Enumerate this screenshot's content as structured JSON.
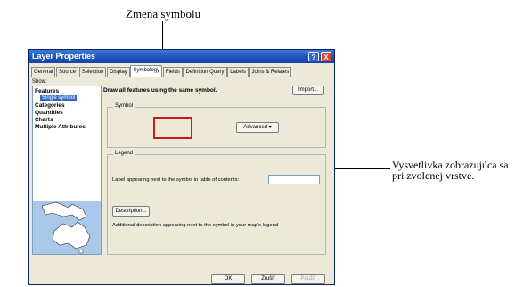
{
  "annotations": {
    "top": "Zmena symbolu",
    "right_line1": "Vysvetlivka zobrazujúca sa",
    "right_line2": "pri zvolenej vrstve."
  },
  "window": {
    "title": "Layer Properties",
    "help": "?",
    "close": "X"
  },
  "tabs": [
    "General",
    "Source",
    "Selection",
    "Display",
    "Symbology",
    "Fields",
    "Definition Query",
    "Labels",
    "Joins & Relates"
  ],
  "active_tab": "Symbology",
  "sidebar": {
    "show_label": "Show:",
    "items": [
      {
        "label": "Features"
      },
      {
        "label": "Single symbol",
        "selected": true
      },
      {
        "label": "Categories"
      },
      {
        "label": "Quantities"
      },
      {
        "label": "Charts"
      },
      {
        "label": "Multiple Attributes"
      }
    ]
  },
  "main": {
    "headline": "Draw all features using the same symbol.",
    "import_button": "Import...",
    "symbol_group": "Symbol",
    "advanced_button": "Advanced ▾",
    "legend_group": "Legend",
    "label_prompt": "Label appearing next to the symbol in table of contents:",
    "label_value": "",
    "description_button": "Description...",
    "description_text": "Additional description appearing next to the symbol in your map's legend"
  },
  "footer": {
    "ok": "OK",
    "cancel": "Zrušiť",
    "apply": "Použiť"
  },
  "colors": {
    "highlight": "#c41b1b",
    "titlebar": "#1d4fb8",
    "map_ocean": "#a9c8ea",
    "map_land": "#ffffff"
  }
}
